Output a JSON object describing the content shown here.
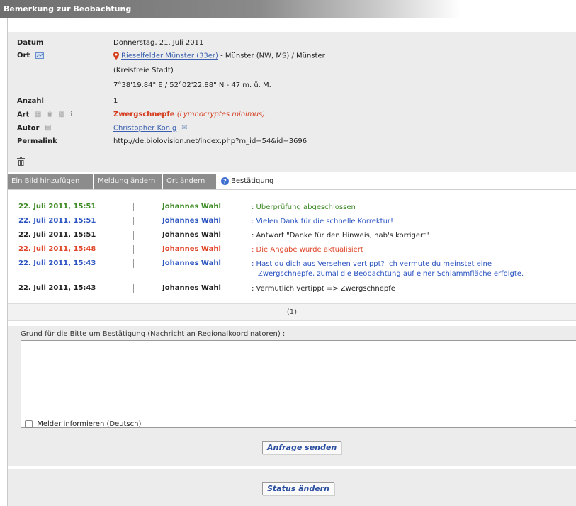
{
  "panel": {
    "title": "Bemerkung zur Beobachtung"
  },
  "fields": {
    "datum_label": "Datum",
    "datum_value": "Donnerstag, 21. Juli 2011",
    "ort_label": "Ort",
    "ort_link": "Rieselfelder Münster (33er)",
    "ort_rest": " - Münster (NW, MS) / Münster",
    "ort_line2": "(Kreisfreie Stadt)",
    "ort_coords": "7°38'19.84\" E / 52°02'22.88\" N - 47 m. ü. M.",
    "anzahl_label": "Anzahl",
    "anzahl_value": "1",
    "art_label": "Art",
    "art_name": "Zwergschnepfe",
    "art_latin": "(Lymnocryptes minimus)",
    "autor_label": "Autor",
    "autor_value": "Christopher König",
    "permalink_label": "Permalink",
    "permalink_value": "http://de.biolovision.net/index.php?m_id=54&id=3696"
  },
  "tabs": {
    "add_image": "Ein Bild hinzufügen",
    "edit_report": "Meldung ändern",
    "edit_location": "Ort ändern",
    "confirmation": "Bestätigung"
  },
  "log": [
    {
      "date": "22. Juli 2011, 15:51",
      "author": "Johannes Wahl",
      "message": ": Überprüfung abgeschlossen",
      "color": "green"
    },
    {
      "date": "22. Juli 2011, 15:51",
      "author": "Johannes Wahl",
      "message": ": Vielen Dank für die schnelle Korrektur!",
      "color": "blue"
    },
    {
      "date": "22. Juli 2011, 15:51",
      "author": "Johannes Wahl",
      "message": ": Antwort \"Danke für den Hinweis, hab's korrigert\"",
      "color": "black"
    },
    {
      "date": "22. Juli 2011, 15:48",
      "author": "Johannes Wahl",
      "message": ": Die Angabe wurde aktualisiert",
      "color": "orange"
    },
    {
      "date": "22. Juli 2011, 15:43",
      "author": "Johannes Wahl",
      "message": ": Hast du dich aus Versehen vertippt? Ich vermute du meinstet eine",
      "message2": "Zwergschnepfe, zumal die Beobachtung auf einer Schlammfläche erfolgte.",
      "color": "blue"
    },
    {
      "date": "22. Juli 2011, 15:43",
      "author": "Johannes Wahl",
      "message": ": Vermutlich vertippt => Zwergschnepfe",
      "color": "black"
    }
  ],
  "pager": {
    "text": "(1)"
  },
  "form": {
    "reason_label": "Grund für die Bitte um Bestätigung (Nachricht an Regionalkoordinatoren) :",
    "reason_value": "",
    "notify_label": "Melder informieren (Deutsch)",
    "send_button": "Anfrage senden",
    "status_button": "Status ändern"
  },
  "colors": {
    "green": "#3c8a24",
    "blue": "#2b54c0",
    "black": "#222222",
    "orange": "#e0462a",
    "link": "#3a5fb0",
    "species": "#d43b1c"
  }
}
